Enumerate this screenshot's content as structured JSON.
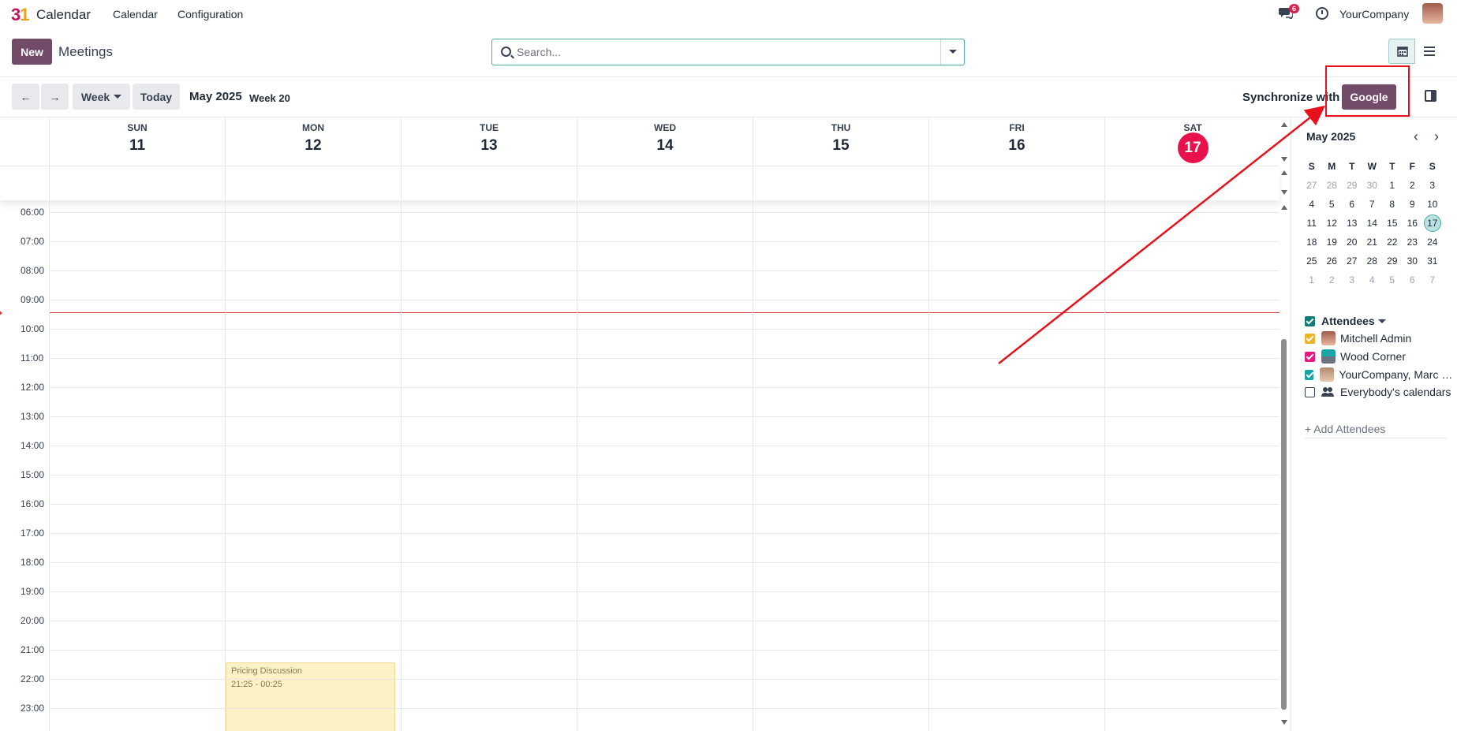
{
  "topnav": {
    "logo_text": "31",
    "app_name": "Calendar",
    "menu": [
      "Calendar",
      "Configuration"
    ],
    "chat_badge": "6",
    "company": "YourCompany"
  },
  "control": {
    "new_label": "New",
    "breadcrumb": "Meetings",
    "search_placeholder": "Search..."
  },
  "toolbar": {
    "prev": "←",
    "next": "→",
    "scale": "Week",
    "today": "Today",
    "period": "May 2025",
    "week": "Week 20",
    "sync_label": "Synchronize with",
    "google_label": "Google"
  },
  "week": {
    "days": [
      {
        "name": "SUN",
        "num": "11"
      },
      {
        "name": "MON",
        "num": "12"
      },
      {
        "name": "TUE",
        "num": "13"
      },
      {
        "name": "WED",
        "num": "14"
      },
      {
        "name": "THU",
        "num": "15"
      },
      {
        "name": "FRI",
        "num": "16"
      },
      {
        "name": "SAT",
        "num": "17",
        "today": true
      }
    ],
    "hours": [
      "06:00",
      "07:00",
      "08:00",
      "09:00",
      "10:00",
      "11:00",
      "12:00",
      "13:00",
      "14:00",
      "15:00",
      "16:00",
      "17:00",
      "18:00",
      "19:00",
      "20:00",
      "21:00",
      "22:00",
      "23:00"
    ]
  },
  "event": {
    "title": "Pricing Discussion",
    "time": "21:25 - 00:25"
  },
  "mini": {
    "title": "May 2025",
    "weekdays": [
      "S",
      "M",
      "T",
      "W",
      "T",
      "F",
      "S"
    ],
    "rows": [
      [
        "27",
        "28",
        "29",
        "30",
        "1",
        "2",
        "3"
      ],
      [
        "4",
        "5",
        "6",
        "7",
        "8",
        "9",
        "10"
      ],
      [
        "11",
        "12",
        "13",
        "14",
        "15",
        "16",
        "17"
      ],
      [
        "18",
        "19",
        "20",
        "21",
        "22",
        "23",
        "24"
      ],
      [
        "25",
        "26",
        "27",
        "28",
        "29",
        "30",
        "31"
      ],
      [
        "1",
        "2",
        "3",
        "4",
        "5",
        "6",
        "7"
      ]
    ],
    "selected": "17"
  },
  "attendees": {
    "header": "Attendees",
    "items": [
      {
        "name": "Mitchell Admin",
        "color": "#f0b429",
        "checked": true
      },
      {
        "name": "Wood Corner",
        "color": "#e6197d",
        "checked": true
      },
      {
        "name": "YourCompany, Marc Demo",
        "color": "#17a2a6",
        "checked": true
      },
      {
        "name": "Everybody's calendars",
        "color": "#ffffff",
        "checked": false
      }
    ],
    "add_label": "+ Add Attendees",
    "header_color": "#0f7b76"
  }
}
